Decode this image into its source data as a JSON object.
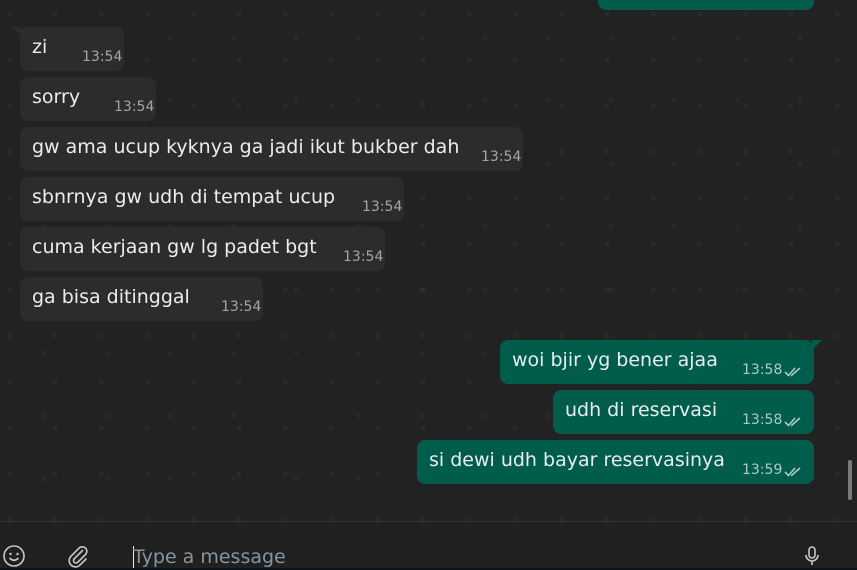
{
  "messages": [
    {
      "text": "zi",
      "time": "13:54"
    },
    {
      "text": "sorry",
      "time": "13:54"
    },
    {
      "text": "gw ama ucup kyknya ga jadi ikut bukber dah",
      "time": "13:54"
    },
    {
      "text": "sbnrnya gw udh di tempat ucup",
      "time": "13:54"
    },
    {
      "text": "cuma kerjaan gw lg padet bgt",
      "time": "13:54"
    },
    {
      "text": "ga bisa ditinggal",
      "time": "13:54"
    },
    {
      "text": "woi bjir yg bener ajaa",
      "time": "13:58"
    },
    {
      "text": "udh di reservasi",
      "time": "13:58"
    },
    {
      "text": "si dewi udh bayar reservasinya",
      "time": "13:59"
    }
  ],
  "composer": {
    "placeholder": "Type a message"
  },
  "icons": {
    "emoji": "emoji-icon",
    "attach": "paperclip-icon",
    "mic": "microphone-icon",
    "read": "double-check-icon"
  },
  "colors": {
    "outgoing_bubble": "#005c4b",
    "incoming_bubble": "#2c2c2c",
    "read_ticks": "#aecbc3"
  }
}
